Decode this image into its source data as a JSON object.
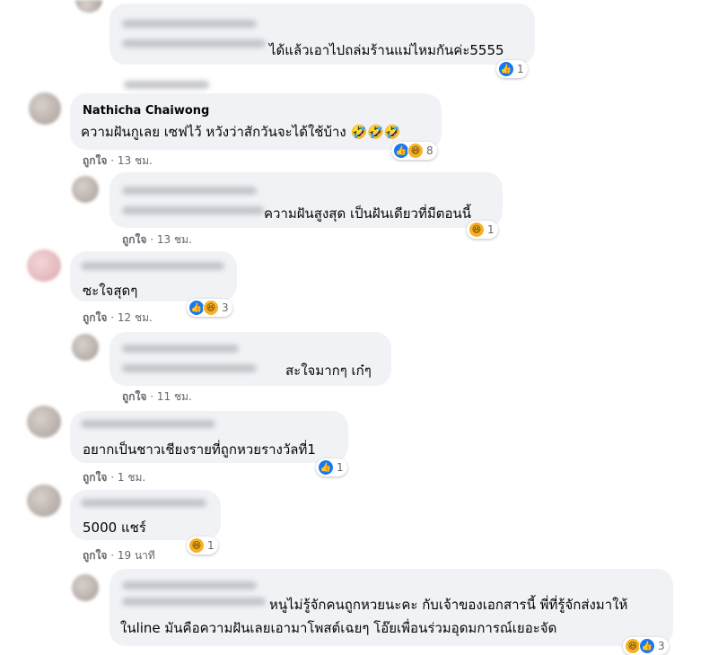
{
  "comments": [
    {
      "text": "ได้แล้วเอาไปถล่มร้านแม่ไหมกันค่ะ5555",
      "reaction_count": "1"
    },
    {
      "author": "Nathicha Chaiwong",
      "text": "ความฝันกูเลย เซฟไว้ หวังว่าสักวันจะได้ใช้บ้าง",
      "emojis": "🤣🤣🤣",
      "reaction_count": "8",
      "like_label": "ถูกใจ",
      "time": "13 ชม."
    },
    {
      "text": "ความฝันสูงสุด เป็นฝันเดียวที่มีตอนนี้",
      "reaction_count": "1",
      "like_label": "ถูกใจ",
      "time": "13 ชม."
    },
    {
      "text": "ซะใจสุดๆ",
      "reaction_count": "3",
      "like_label": "ถูกใจ",
      "time": "12 ชม."
    },
    {
      "text": "สะใจมากๆ เก๋ๆ",
      "like_label": "ถูกใจ",
      "time": "11 ชม."
    },
    {
      "text": "อยากเป็นชาวเชียงรายที่ถูกหวยรางวัลที่1",
      "reaction_count": "1",
      "like_label": "ถูกใจ",
      "time": "1 ชม."
    },
    {
      "text": "5000 แชร์",
      "reaction_count": "1",
      "like_label": "ถูกใจ",
      "time": "19 นาที"
    },
    {
      "text_line1": "หนูไม่รู้จักคนถูกหวยนะคะ กับเจ้าของเอกสารนี้ พี่ที่รู้จักส่งมาให้",
      "text_line2": "ในline มันคือความฝันเลยเอามาโพสต์เฉยๆ โอ๊ยเพื่อนร่วมอุดมการณ์เยอะจัด",
      "reaction_count": "3"
    }
  ],
  "sep": " · ",
  "icons": {
    "like": "thumbs-up-icon",
    "haha": "haha-emoji-icon"
  },
  "colors": {
    "bubble": "#f0f2f5",
    "like_blue": "#1877f2",
    "haha_yellow": "#f7b125",
    "meta_gray": "#65676b"
  }
}
